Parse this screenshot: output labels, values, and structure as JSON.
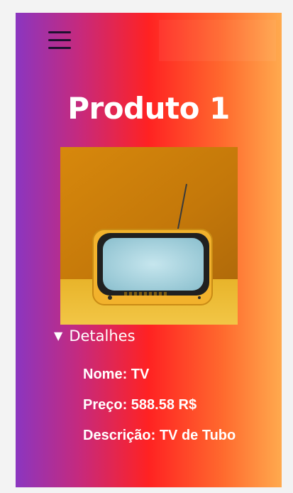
{
  "page": {
    "title": "Produto 1",
    "image_alt": "TV"
  },
  "menu": {
    "icon": "hamburger-menu-icon"
  },
  "details": {
    "summary_label": "Detalhes",
    "marker": "▼",
    "items": [
      {
        "text": "Nome: TV"
      },
      {
        "text": "Preço: 588.58 R$"
      },
      {
        "text": "Descrição: TV de Tubo"
      }
    ]
  },
  "colors": {
    "gradient": [
      "#8b36c0",
      "#c8297a",
      "#ff2222",
      "#ff6a2e",
      "#ffaa4e"
    ],
    "text": "#ffffff",
    "menu_icon": "#1e1030"
  }
}
